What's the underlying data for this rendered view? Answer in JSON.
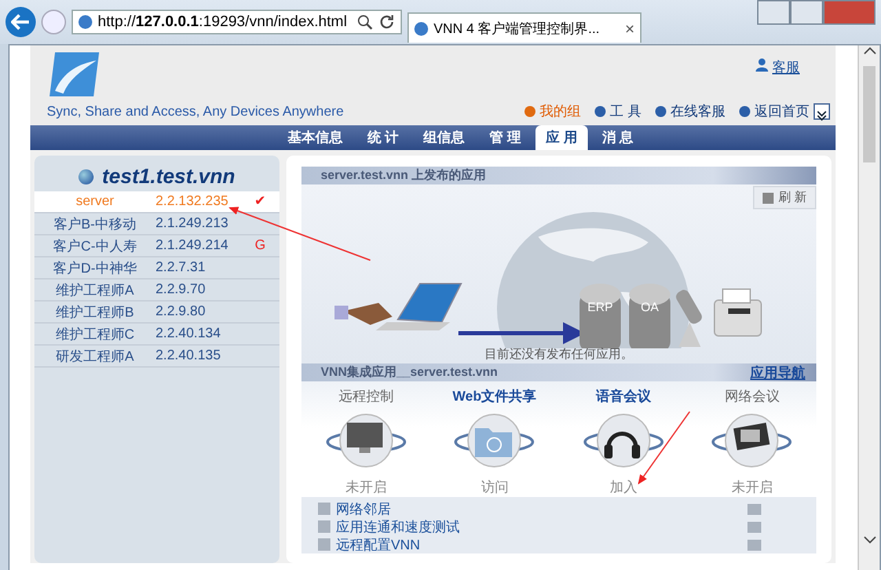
{
  "browser": {
    "address": "http://**127.0.0.1**:19293/vnn/index.html",
    "tab_title": "VNN 4 客户端管理控制界...",
    "tab_close": "×"
  },
  "header": {
    "support_link": "客服",
    "slogan": "Sync, Share and Access, Any Devices Anywhere",
    "links": [
      {
        "label": "我的组",
        "selected": true
      },
      {
        "label": "工 具",
        "selected": false
      },
      {
        "label": "在线客服",
        "selected": false
      },
      {
        "label": "返回首页",
        "selected": false
      }
    ]
  },
  "nav_tabs": [
    {
      "label": "基本信息",
      "selected": false
    },
    {
      "label": "统 计",
      "selected": false
    },
    {
      "label": "组信息",
      "selected": false
    },
    {
      "label": "管 理",
      "selected": false
    },
    {
      "label": "应 用",
      "selected": true
    },
    {
      "label": "消 息",
      "selected": false
    }
  ],
  "sidebar": {
    "title": "test1.test.vnn",
    "rows": [
      {
        "name": "server",
        "ip": "2.2.132.235",
        "mark": "✔",
        "selected": true
      },
      {
        "name": "客户B-中移动",
        "ip": "2.1.249.213",
        "selected": false
      },
      {
        "name": "客户C-中人寿",
        "ip": "2.1.249.214",
        "mark": "G",
        "selected": false
      },
      {
        "name": "客户D-中神华",
        "ip": "2.2.7.31",
        "selected": false
      },
      {
        "name": "维护工程师A",
        "ip": "2.2.9.70",
        "selected": false
      },
      {
        "name": "维护工程师B",
        "ip": "2.2.9.80",
        "selected": false
      },
      {
        "name": "维护工程师C",
        "ip": "2.2.40.134",
        "selected": false
      },
      {
        "name": "研发工程师A",
        "ip": "2.2.40.135",
        "selected": false
      }
    ]
  },
  "published": {
    "title": "server.test.vnn 上发布的应用",
    "refresh": "刷 新",
    "labels": [
      "ERP",
      "OA"
    ],
    "empty_message": "目前还没有发布任何应用。"
  },
  "integrated": {
    "title": "VNN集成应用__server.test.vnn",
    "nav_link": "应用导航",
    "apps": [
      {
        "kind": "remote",
        "name": "远程控制",
        "status": "未开启",
        "enabled": false
      },
      {
        "kind": "files",
        "name": "Web文件共享",
        "status": "访问",
        "enabled": true
      },
      {
        "kind": "voice",
        "name": "语音会议",
        "status": "加入",
        "enabled": true
      },
      {
        "kind": "meeting",
        "name": "网络会议",
        "status": "未开启",
        "enabled": false
      }
    ],
    "links": [
      "网络邻居",
      "应用连通和速度测试",
      "远程配置VNN"
    ]
  }
}
